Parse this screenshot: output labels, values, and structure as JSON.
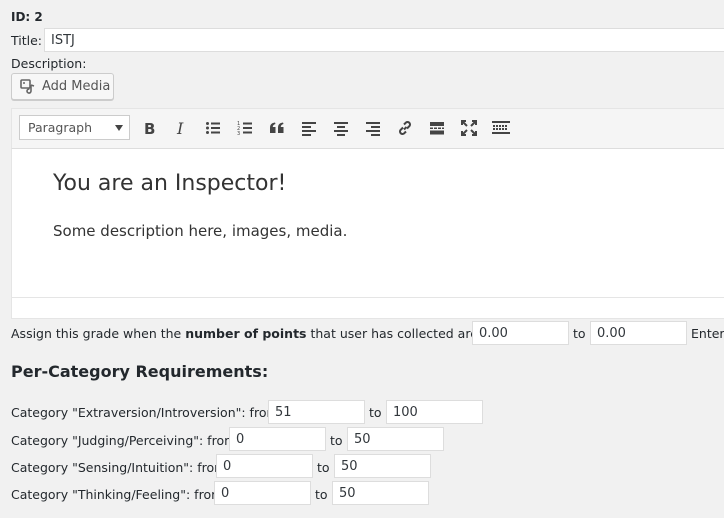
{
  "record": {
    "id_label": "ID: 2"
  },
  "title_field": {
    "label": "Title:",
    "value": "ISTJ"
  },
  "description": {
    "label": "Description:",
    "add_media_label": "Add Media"
  },
  "toolbar": {
    "format_select": "Paragraph",
    "buttons": [
      "bold-icon",
      "italic-icon",
      "bullet-list-icon",
      "numbered-list-icon",
      "blockquote-icon",
      "align-left-icon",
      "align-center-icon",
      "align-right-icon",
      "link-icon",
      "read-more-icon",
      "fullscreen-icon",
      "toolbar-toggle-icon"
    ]
  },
  "editor": {
    "heading": "You are an Inspector!",
    "paragraph": "Some description here, images, media."
  },
  "points_rule": {
    "prefix": "Assign this grade when the ",
    "bold": "number of points",
    "suffix": " that user has collected are from",
    "from_value": "0.00",
    "to_label": "to",
    "to_value": "0.00",
    "trailing": "Enter"
  },
  "per_category": {
    "heading": "Per-Category Requirements:",
    "rows": [
      {
        "label": "Category \"Extraversion/Introversion\": from",
        "from": "51",
        "to_label": "to",
        "to": "100"
      },
      {
        "label": "Category \"Judging/Perceiving\": from",
        "from": "0",
        "to_label": "to",
        "to": "50"
      },
      {
        "label": "Category \"Sensing/Intuition\": from",
        "from": "0",
        "to_label": "to",
        "to": "50"
      },
      {
        "label": "Category \"Thinking/Feeling\": from",
        "from": "0",
        "to_label": "to",
        "to": "50"
      }
    ]
  },
  "colors": {
    "background": "#f1f1f1",
    "border": "#ddd",
    "text": "#23282d",
    "icon": "#444"
  }
}
